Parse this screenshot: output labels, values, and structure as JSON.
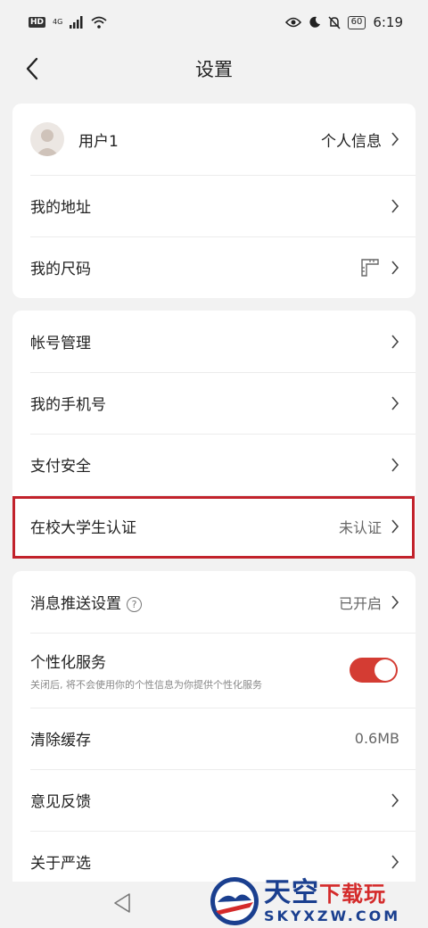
{
  "status_bar": {
    "left_badge": "HD",
    "network": "4G",
    "battery": "60",
    "time": "6:19"
  },
  "header": {
    "title": "设置"
  },
  "profile": {
    "name": "用户1",
    "link_label": "个人信息"
  },
  "group1": {
    "items": [
      {
        "label": "我的地址"
      },
      {
        "label": "我的尺码"
      }
    ]
  },
  "group2": {
    "items": [
      {
        "label": "帐号管理"
      },
      {
        "label": "我的手机号"
      },
      {
        "label": "支付安全"
      },
      {
        "label": "在校大学生认证",
        "value": "未认证"
      }
    ]
  },
  "group3": {
    "push": {
      "label": "消息推送设置",
      "help": "?",
      "value": "已开启"
    },
    "personal": {
      "label": "个性化服务",
      "sub": "关闭后, 将不会使用你的个性信息为你提供个性化服务",
      "enabled": true
    },
    "cache": {
      "label": "清除缓存",
      "value": "0.6MB"
    },
    "feedback": {
      "label": "意见反馈"
    },
    "about": {
      "label": "关于严选"
    }
  },
  "watermark": {
    "title_main": "天空",
    "title_accent": "下载玩",
    "url": "SKYXZW.COM"
  },
  "colors": {
    "accent": "#d43c33",
    "highlight": "#c2222b",
    "background": "#f2f2f2"
  }
}
